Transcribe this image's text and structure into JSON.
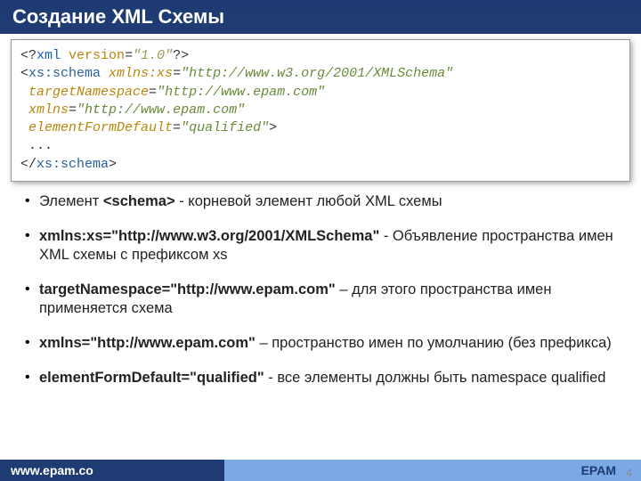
{
  "header": {
    "title": "Создание XML Схемы"
  },
  "code": {
    "l1_open": "<?",
    "l1_xml": "xml",
    "l1_sp": " ",
    "l1_verk": "version",
    "l1_eq": "=",
    "l1_verv": "\"1.0\"",
    "l1_close": "?>",
    "l2_open": "<",
    "l2_tag": "xs:schema",
    "l2_sp": " ",
    "l2_attr": "xmlns:xs",
    "l2_eq": "=",
    "l2_val": "\"http://www.w3.org/2001/XMLSchema\"",
    "l3_pad": " ",
    "l3_attr": "targetNamespace",
    "l3_eq": "=",
    "l3_val": "\"http://www.epam.com\"",
    "l4_pad": " ",
    "l4_attr": "xmlns",
    "l4_eq": "=",
    "l4_val": "\"http://www.epam.com\"",
    "l5_pad": " ",
    "l5_attr": "elementFormDefault",
    "l5_eq": "=",
    "l5_val": "\"qualified\"",
    "l5_close": ">",
    "l6": " ...",
    "l7_open": "</",
    "l7_tag": "xs:schema",
    "l7_close": ">"
  },
  "bullets": {
    "b1_a": "Элемент ",
    "b1_b": "<schema>",
    "b1_c": " - корневой элемент любой XML схемы",
    "b2_a": "xmlns:xs=\"http://www.w3.org/2001/XMLSchema\"",
    "b2_b": "  - Объявление пространства имен XML схемы с префиксом xs",
    "b3_a": "targetNamespace=\"http://www.epam.com\"",
    "b3_b": " – для этого пространства имен применяется схема",
    "b4_a": "xmlns=\"http://www.epam.com\"",
    "b4_b": " – пространство имен по умолчанию (без префикса)",
    "b5_a": "elementFormDefault=\"qualified\"",
    "b5_b": " - все элементы должны быть namespace qualified"
  },
  "footer": {
    "url": "www.epam.co",
    "brand": "EPAM",
    "page": "4"
  }
}
